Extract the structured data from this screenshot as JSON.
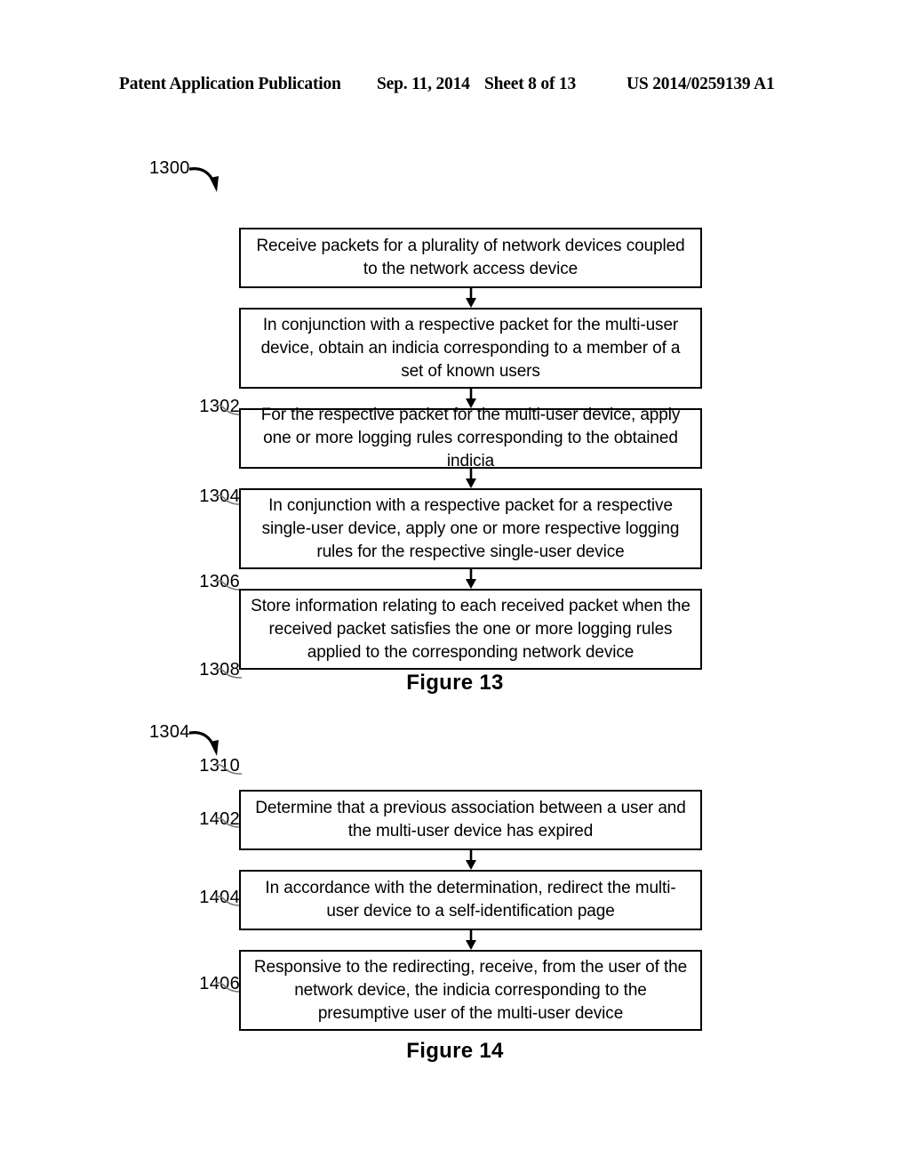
{
  "header": {
    "publication": "Patent Application Publication",
    "date": "Sep. 11, 2014",
    "sheet": "Sheet 8 of 13",
    "patent_number": "US 2014/0259139 A1"
  },
  "figures": [
    {
      "flow_id": "1300",
      "caption": "Figure 13",
      "steps": [
        {
          "ref": "1302",
          "text": "Receive packets for a plurality of network devices coupled to the network access device"
        },
        {
          "ref": "1304",
          "text": "In conjunction with a respective packet for the multi-user device, obtain an indicia corresponding to a member of a set of known users"
        },
        {
          "ref": "1306",
          "text": "For the respective packet for the multi-user device, apply one or more logging rules corresponding to the obtained indicia"
        },
        {
          "ref": "1308",
          "text": "In conjunction with a respective packet for a respective single-user device, apply one or more respective logging rules for the respective single-user device"
        },
        {
          "ref": "1310",
          "text": "Store information relating to each received packet when the received packet satisfies the one or more logging rules applied to the corresponding network device"
        }
      ]
    },
    {
      "flow_id": "1304",
      "caption": "Figure 14",
      "steps": [
        {
          "ref": "1402",
          "text": "Determine that a previous association between a user and the multi-user device has expired"
        },
        {
          "ref": "1404",
          "text": "In accordance with the determination, redirect the multi-user device to a self-identification page"
        },
        {
          "ref": "1406",
          "text": "Responsive to the redirecting, receive, from the user of the network device, the indicia corresponding to the presumptive user of the multi-user device"
        }
      ]
    }
  ]
}
